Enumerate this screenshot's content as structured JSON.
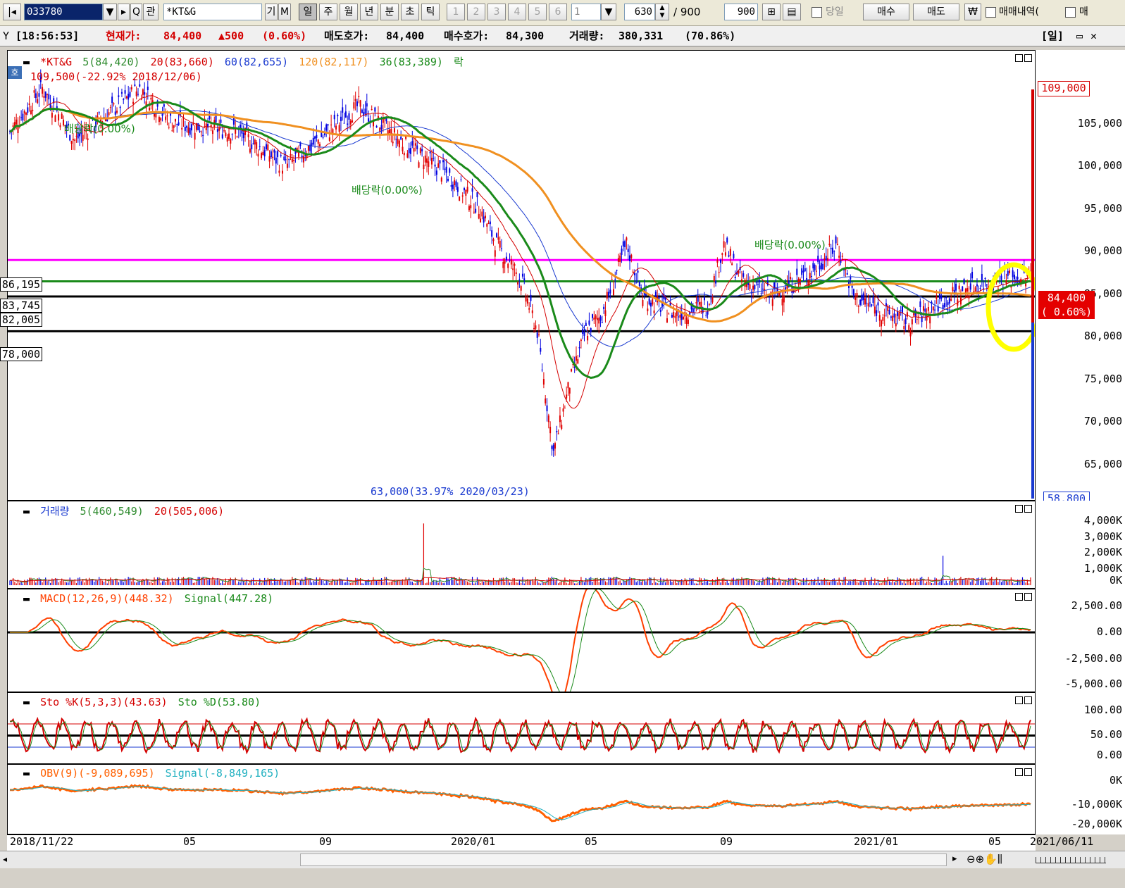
{
  "toolbar": {
    "code": "033780",
    "name": "*KT&G",
    "btn_gi": "기",
    "btn_m": "M",
    "periods": [
      "일",
      "주",
      "월",
      "년",
      "분",
      "초",
      "틱"
    ],
    "minute_btns": [
      "1",
      "2",
      "3",
      "4",
      "5",
      "6"
    ],
    "minute_select": "1",
    "count": "630",
    "count_total": "/ 900",
    "count_max": "900",
    "same_day_label": "당일",
    "buy_label": "매수",
    "sell_label": "매도",
    "won_label": "₩",
    "trade_history_label": "매매내역(",
    "trade_label2": "매"
  },
  "ticker": {
    "time": "[18:56:53]",
    "price_label": "현재가:",
    "price": "84,400",
    "change": "▲500",
    "change_pct": "(0.60%)",
    "ask_label": "매도호가:",
    "ask": "84,400",
    "bid_label": "매수호가:",
    "bid": "84,300",
    "vol_label": "거래량:",
    "volume": "380,331",
    "vol_pct": "(70.86%)",
    "period_tag": "[일]"
  },
  "price_pane": {
    "legend": [
      {
        "text": "*KT&G",
        "color": "#d40000"
      },
      {
        "text": "5(84,420)",
        "color": "#2e8b2e"
      },
      {
        "text": "20(83,660)",
        "color": "#d40000"
      },
      {
        "text": "60(82,655)",
        "color": "#1a3ad0"
      },
      {
        "text": "120(82,117)",
        "color": "#f09020"
      },
      {
        "text": "36(83,389)",
        "color": "#1a8a1a"
      },
      {
        "text": "락",
        "color": "#1a8a1a"
      }
    ],
    "badge": "호",
    "high_note": "109,500(-22.92% 2018/12/06)",
    "low_note": "63,000(33.97% 2020/03/23)",
    "dividend_notes": [
      "배당락(0.00%)",
      "배당락(0.00%)",
      "배당락(0.00%)"
    ],
    "hlines": [
      {
        "label": "86,195",
        "value": 86195,
        "color": "#ff00ff"
      },
      {
        "label": "83,745",
        "value": 83745,
        "color": "#1a8a1a"
      },
      {
        "label": "82,005",
        "value": 82005,
        "color": "#000000"
      },
      {
        "label": "78,000",
        "value": 78000,
        "color": "#000000"
      }
    ],
    "yticks": [
      "105,000",
      "100,000",
      "95,000",
      "90,000",
      "85,000",
      "80,000",
      "75,000",
      "70,000",
      "65,000"
    ],
    "ymax_label": "109,000",
    "ymin_label": "58,800",
    "current_price": "84,400",
    "current_pct": "( 0.60%)"
  },
  "volume_pane": {
    "legend": [
      {
        "text": "거래량",
        "color": "#1a3ad0"
      },
      {
        "text": "5(460,549)",
        "color": "#2e8b2e"
      },
      {
        "text": "20(505,006)",
        "color": "#d40000"
      }
    ],
    "yticks": [
      "4,000K",
      "3,000K",
      "2,000K",
      "1,000K",
      "0K"
    ]
  },
  "macd_pane": {
    "legend": [
      {
        "text": "MACD(12,26,9)(448.32)",
        "color": "#ff4000"
      },
      {
        "text": "Signal(447.28)",
        "color": "#1a8a1a"
      }
    ],
    "yticks": [
      "2,500.00",
      "0.00",
      "-2,500.00",
      "-5,000.00"
    ]
  },
  "stoch_pane": {
    "legend": [
      {
        "text": "Sto %K(5,3,3)(43.63)",
        "color": "#d40000"
      },
      {
        "text": "Sto %D(53.80)",
        "color": "#1a8a1a"
      }
    ],
    "yticks": [
      "100.00",
      "50.00",
      "0.00"
    ]
  },
  "obv_pane": {
    "legend": [
      {
        "text": "OBV(9)(-9,089,695)",
        "color": "#ff6000"
      },
      {
        "text": "Signal(-8,849,165)",
        "color": "#20b0c0"
      }
    ],
    "yticks": [
      "0K",
      "-10,000K",
      "-20,000K"
    ]
  },
  "xaxis": [
    "2018/11/22",
    "05",
    "09",
    "2020/01",
    "05",
    "09",
    "2021/01",
    "05",
    "2021/06/11"
  ],
  "colors": {
    "up": "#e00000",
    "down": "#0000e0",
    "ma5": "#2e8b2e",
    "ma20": "#d40000",
    "ma60": "#1a3ad0",
    "ma120": "#f09020",
    "ma36": "#1a8a1a",
    "highlight": "#ffff00"
  }
}
